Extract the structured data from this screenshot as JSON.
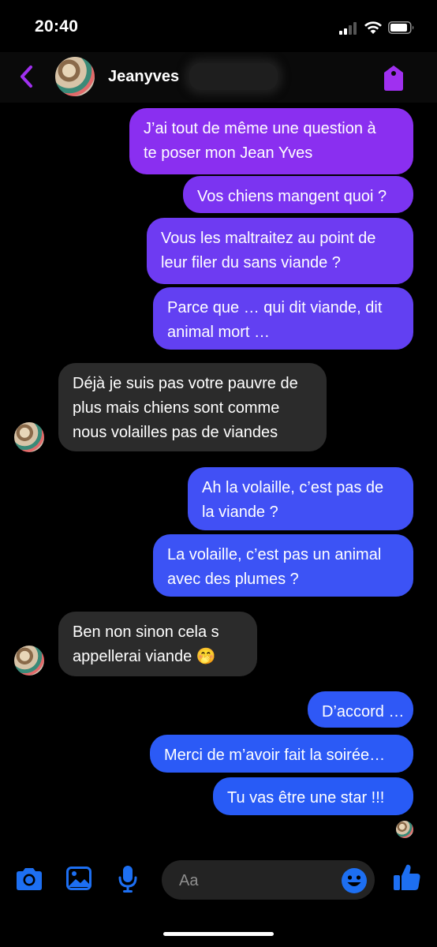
{
  "status_bar": {
    "time": "20:40"
  },
  "header": {
    "contact_name": "Jeanyves"
  },
  "messages": [
    {
      "side": "out",
      "lines": [
        "J’ai tout de même une question à",
        "te poser mon Jean Yves"
      ],
      "color": "#8a2ff0"
    },
    {
      "side": "out",
      "lines": [
        "Vos chiens mangent quoi ?"
      ],
      "color": "#7b34f1"
    },
    {
      "side": "out",
      "lines": [
        "Vous les maltraitez au point de",
        "leur filer du sans viande ?"
      ],
      "color": "#6e3bf2"
    },
    {
      "side": "out",
      "lines": [
        "Parce que … qui dit viande, dit",
        "animal mort …"
      ],
      "color": "#6240f2"
    },
    {
      "side": "in",
      "lines": [
        "Déjà je suis pas votre pauvre de",
        "plus mais chiens sont comme",
        "nous volailles pas de viandes"
      ]
    },
    {
      "side": "out",
      "lines": [
        "Ah la volaille, c’est pas de",
        "la viande ?"
      ],
      "color": "#4150f5"
    },
    {
      "side": "out",
      "lines": [
        "La volaille, c’est pas un animal",
        "avec des plumes ?"
      ],
      "color": "#3c53f5"
    },
    {
      "side": "in",
      "lines": [
        "Ben non sinon cela s",
        "appellerai viande 🤭"
      ]
    },
    {
      "side": "out",
      "lines": [
        "D’accord …"
      ],
      "color": "#2f58f6"
    },
    {
      "side": "out",
      "lines": [
        "Merci de m’avoir fait la soirée…"
      ],
      "color": "#2b5af6"
    },
    {
      "side": "out",
      "lines": [
        "Tu vas être une star !!!"
      ],
      "color": "#285bf6"
    }
  ],
  "composer": {
    "placeholder": "Aa",
    "icons": [
      "camera-icon",
      "image-icon",
      "microphone-icon",
      "emoji-icon",
      "thumbs-up-icon"
    ],
    "accent": "#1d6ff2"
  },
  "colors": {
    "header_accent": "#a030f0",
    "incoming_bubble": "#2b2b2b"
  }
}
